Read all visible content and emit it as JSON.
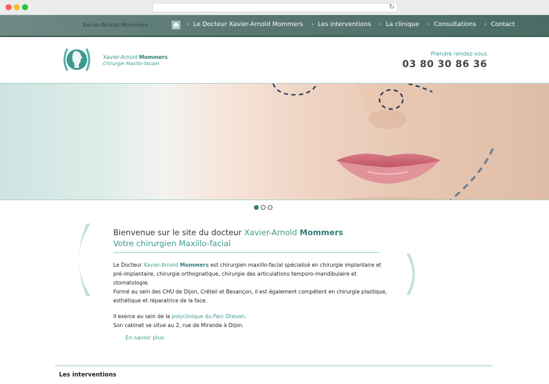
{
  "nav": {
    "site_name": "Xavier-Arnold Mommers",
    "items": [
      {
        "label": "Le Docteur Xavier-Arnold Mommers"
      },
      {
        "label": "Les interventions"
      },
      {
        "label": "La clinique"
      },
      {
        "label": "Consultations"
      },
      {
        "label": "Contact"
      }
    ]
  },
  "header": {
    "logo_name_light": "Xavier-Arnold ",
    "logo_name_bold": "Mommers",
    "logo_subtitle": "Chirurgie Maxillo-faciale",
    "appointment_label": "Prendre rendez-vous",
    "appointment_phone": "03 80 30 86 36"
  },
  "slider": {
    "dot_count": 3,
    "active_index": 0
  },
  "welcome": {
    "title_prefix": "Bienvenue sur le site du docteur ",
    "title_name": "Xavier-Arnold ",
    "title_name_bold": "Mommers",
    "subtitle": "Votre chirurgien Maxillo-facial",
    "p1_prefix": "Le Docteur ",
    "p1_name": "Xavier-Arnold ",
    "p1_name_bold": "Mommers",
    "p1_text": " est chirurgien maxillo-facial spécialisé en chirurgie implantaire et pré-implantaire, chirurgie orthognatique, chirurgie des articulations temporo-mandibulaire et stomatologie.",
    "p1_text2": "Formé au sein des CHU de Dijon, Créteil et Besançon, il est également compétent en chirurgie plastique, esthétique et réparatrice de la face.",
    "p2_prefix": "Il exerce au sein de la ",
    "p2_link": "polyclinique du Parc Drevon",
    "p2_suffix": ".",
    "p2_text2": "Son cabinet se situe au 2, rue de Mirande à Dijon.",
    "more_link": "En savoir plus"
  },
  "section": {
    "heading": "Les interventions"
  },
  "colors": {
    "accent": "#3c9a8e",
    "nav_bg": "#587770",
    "text": "#222222"
  }
}
